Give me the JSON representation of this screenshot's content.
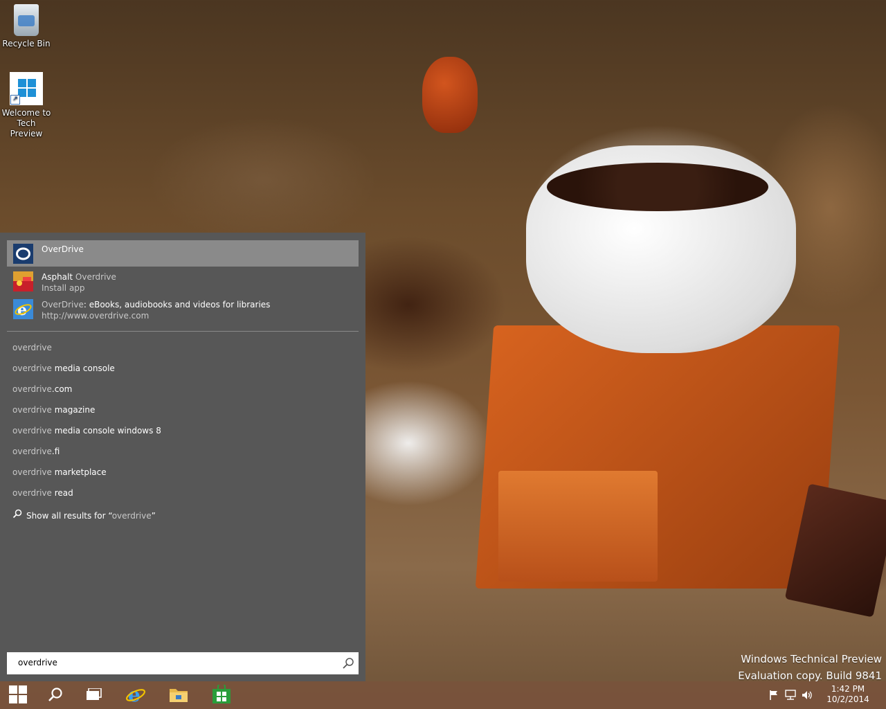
{
  "desktop": {
    "icons": [
      {
        "label": "Recycle Bin",
        "icon": "recycle-bin-icon"
      },
      {
        "label_line1": "Welcome to",
        "label_line2": "Tech Preview",
        "icon": "windows-logo-icon"
      }
    ]
  },
  "search": {
    "results": [
      {
        "title": "OverDrive",
        "icon": "overdrive-app-icon",
        "selected": true
      },
      {
        "title_bold": "Asphalt",
        "title_rest": " Overdrive",
        "subtitle": "Install app",
        "icon": "asphalt-game-icon"
      },
      {
        "title_rest_dim": "OverDrive",
        "title_bold": ": eBooks, audiobooks and videos for libraries",
        "subtitle": "http://www.overdrive.com",
        "icon": "internet-explorer-icon"
      }
    ],
    "suggestions": [
      {
        "query": "overdrive",
        "rest": ""
      },
      {
        "query": "overdrive",
        "rest": " media console"
      },
      {
        "query": "overdrive",
        "rest": ".com"
      },
      {
        "query": "overdrive",
        "rest": " magazine"
      },
      {
        "query": "overdrive",
        "rest": " media console windows 8"
      },
      {
        "query": "overdrive",
        "rest": ".fi"
      },
      {
        "query": "overdrive",
        "rest": " marketplace"
      },
      {
        "query": "overdrive",
        "rest": " read"
      }
    ],
    "show_all_prefix": "Show all results for “",
    "show_all_query": "overdrive",
    "show_all_suffix": "”",
    "input_value": "overdrive"
  },
  "watermark": {
    "line1": "Windows Technical Preview",
    "line2": "Evaluation copy. Build 9841"
  },
  "taskbar": {
    "buttons": [
      "start-button",
      "search-button",
      "task-view-button",
      "internet-explorer-button",
      "file-explorer-button",
      "store-button"
    ],
    "tray_icons": [
      "action-center-flag-icon",
      "network-icon",
      "volume-icon"
    ],
    "time": "1:42 PM",
    "date": "10/2/2014"
  },
  "colors": {
    "panel_bg": "#575757",
    "selected_bg": "#8a8a8a",
    "accent_blue": "#1e90d6"
  }
}
